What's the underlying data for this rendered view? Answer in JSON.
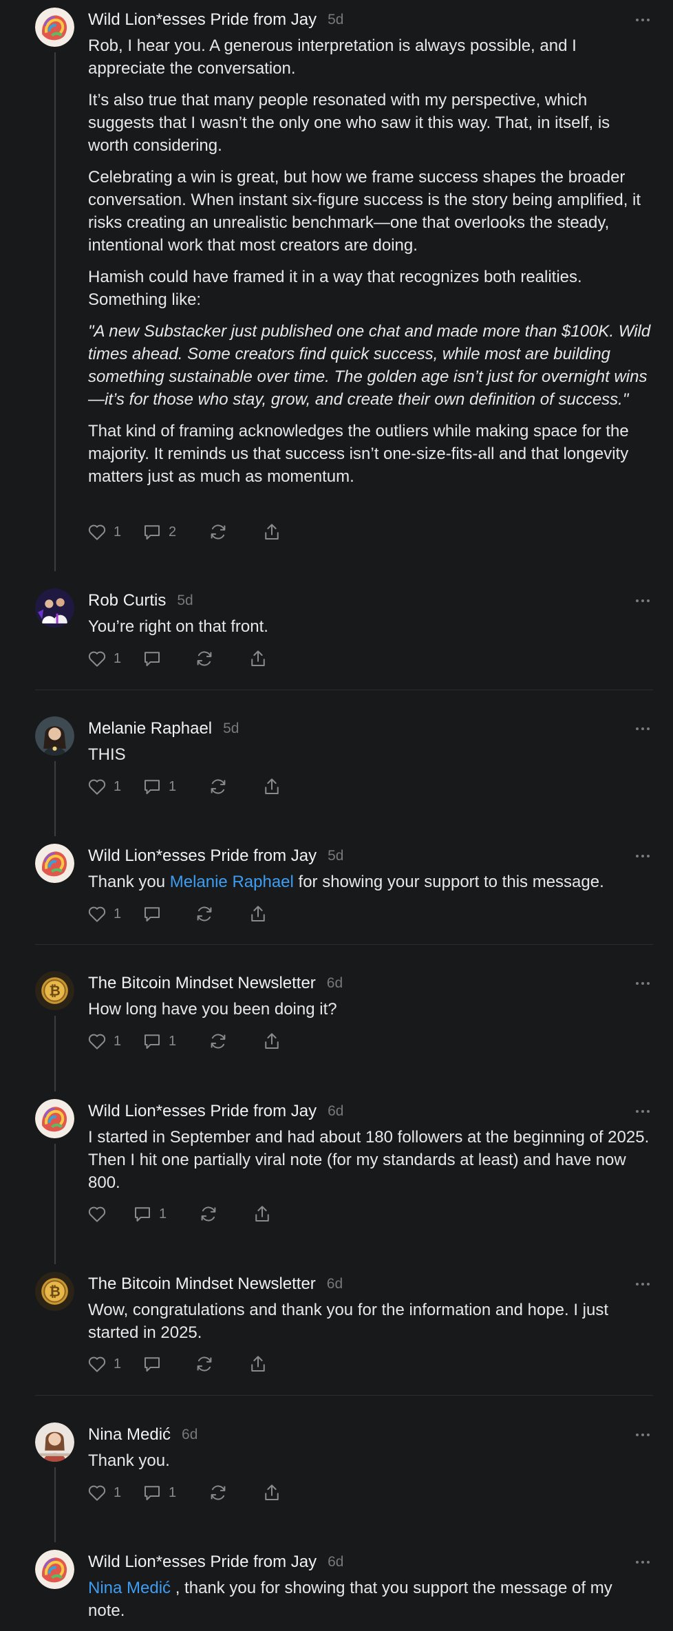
{
  "comments": [
    {
      "author": "Wild Lion*esses Pride from Jay",
      "time": "5d",
      "avatar": "lion-avatar",
      "paragraphs": [
        "Rob, I hear you. A generous interpretation is always possible, and I appreciate the conversation.",
        "It’s also true that many people resonated with my perspective, which suggests that I wasn’t the only one who saw it this way. That, in itself, is worth considering.",
        "Celebrating a win is great, but how we frame success shapes the broader conversation. When instant six-figure success is the story being amplified, it risks creating an unrealistic benchmark—one that overlooks the steady, intentional work that most creators are doing.",
        "Hamish could have framed it in a way that recognizes both realities. Something like:",
        "\"A new Substacker just published one chat and made more than $100K. Wild times ahead. Some creators find quick success, while most are building something sustainable over time. The golden age isn’t just for overnight wins—it’s for those who stay, grow, and create their own definition of success.\"",
        "That kind of framing acknowledges the outliers while making space for the majority. It reminds us that success isn’t one-size-fits-all and that longevity matters just as much as momentum."
      ],
      "likes": "1",
      "replies": "2"
    },
    {
      "author": "Rob Curtis",
      "time": "5d",
      "avatar": "people-avatar",
      "text": "You’re right on that front.",
      "likes": "1",
      "replies": ""
    },
    {
      "author": "Melanie Raphael",
      "time": "5d",
      "avatar": "woman-avatar",
      "text": "THIS",
      "likes": "1",
      "replies": "1"
    },
    {
      "author": "Wild Lion*esses Pride from Jay",
      "time": "5d",
      "avatar": "lion-avatar",
      "text_before": "Thank you ",
      "mention": "Melanie Raphael",
      "text_after": " for showing your support to this message.",
      "likes": "1",
      "replies": ""
    },
    {
      "author": "The Bitcoin Mindset Newsletter",
      "time": "6d",
      "avatar": "bitcoin-avatar",
      "text": "How long have you been doing it?",
      "likes": "1",
      "replies": "1"
    },
    {
      "author": "Wild Lion*esses Pride from Jay",
      "time": "6d",
      "avatar": "lion-avatar",
      "text": "I started in September and had about 180 followers at the beginning of 2025. Then I hit one partially viral note (for my standards at least) and have now 800.",
      "likes": "",
      "replies": "1"
    },
    {
      "author": "The Bitcoin Mindset Newsletter",
      "time": "6d",
      "avatar": "bitcoin-avatar",
      "text": "Wow, congratulations and thank you for the information and hope. I just started in 2025.",
      "likes": "1",
      "replies": ""
    },
    {
      "author": "Nina Medić",
      "time": "6d",
      "avatar": "woman-avatar",
      "text": "Thank you.",
      "likes": "1",
      "replies": "1"
    },
    {
      "author": "Wild Lion*esses Pride from Jay",
      "time": "6d",
      "avatar": "lion-avatar",
      "mention": "Nina Medić",
      "text_after": " , thank you for showing that you support the message of my note."
    }
  ],
  "colors": {
    "background": "#18191b",
    "mention": "#3d9df2",
    "thread_line": "#3c3d40"
  },
  "icons": [
    "heart-icon",
    "comment-icon",
    "restack-icon",
    "share-icon",
    "more-options-icon"
  ]
}
